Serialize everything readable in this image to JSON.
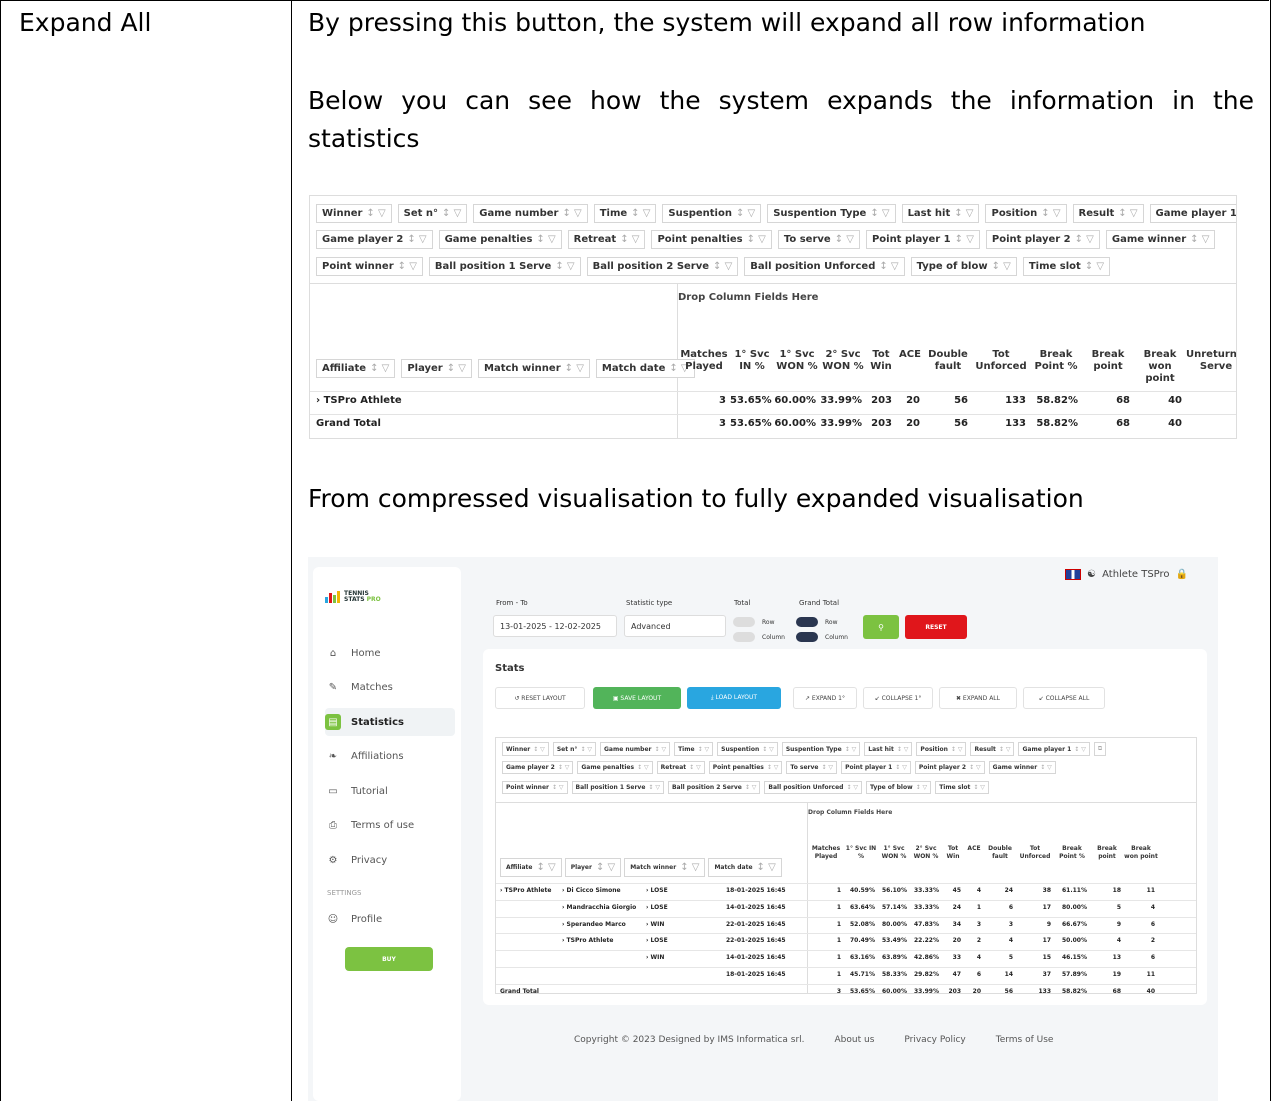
{
  "left_cell": "Expand All",
  "paragraphs": {
    "p1": "By pressing this button, the system will expand all row information",
    "p2": "Below you can see how the system expands the information in the statistics",
    "p3": "From compressed visualisation to fully expanded visualisation"
  },
  "pivot_fields": {
    "row1": [
      "Winner",
      "Set n°",
      "Game number",
      "Time",
      "Suspention",
      "Suspention Type",
      "Last hit",
      "Position",
      "Result",
      "Game player 1"
    ],
    "row2": [
      "Game player 2",
      "Game penalties",
      "Retreat",
      "Point penalties",
      "To serve",
      "Point player 1",
      "Point player 2",
      "Game winner"
    ],
    "row3": [
      "Point winner",
      "Ball position 1 Serve",
      "Ball position 2 Serve",
      "Ball position Unforced",
      "Type of blow",
      "Time slot"
    ],
    "drop_text": "Drop Column Fields Here",
    "row_headers": [
      "Affiliate",
      "Player",
      "Match winner",
      "Match date"
    ],
    "columns": [
      "Matches Played",
      "1° Svc IN %",
      "1° Svc WON %",
      "2° Svc WON %",
      "Tot Win",
      "ACE",
      "Double fault",
      "Tot Unforced",
      "Break Point %",
      "Break point",
      "Break won point",
      "Unreturned Serve"
    ]
  },
  "shot1": {
    "rows": [
      {
        "label": "TSPro Athlete",
        "values": [
          "3",
          "53.65%",
          "60.00%",
          "33.99%",
          "203",
          "20",
          "56",
          "133",
          "58.82%",
          "68",
          "40",
          "("
        ]
      },
      {
        "label": "Grand Total",
        "values": [
          "3",
          "53.65%",
          "60.00%",
          "33.99%",
          "203",
          "20",
          "56",
          "133",
          "58.82%",
          "68",
          "40",
          "("
        ]
      }
    ]
  },
  "shot2": {
    "logo": {
      "line1": "TENNIS",
      "line2": "STATS",
      "line3": "PRO"
    },
    "nav": [
      "Home",
      "Matches",
      "Statistics",
      "Affiliations",
      "Tutorial",
      "Terms of use",
      "Privacy"
    ],
    "settings_heading": "SETTINGS",
    "profile": "Profile",
    "buy": "BUY",
    "user": "Athlete TSPro",
    "filters": {
      "from_to_label": "From - To",
      "from_to_value": "13-01-2025 - 12-02-2025",
      "statistic_type_label": "Statistic type",
      "statistic_type_value": "Advanced",
      "total_label": "Total",
      "grand_total_label": "Grand Total",
      "row": "Row",
      "column": "Column",
      "reset": "RESET"
    },
    "stats_title": "Stats",
    "toolbar": [
      "RESET LAYOUT",
      "SAVE LAYOUT",
      "LOAD LAYOUT",
      "EXPAND 1°",
      "COLLAPSE 1°",
      "EXPAND ALL",
      "COLLAPSE ALL"
    ],
    "affiliate": "TSPro Athlete",
    "players": [
      "Di Cicco Simone",
      "Mandracchia Giorgio",
      "Sperandeo Marco",
      "TSPro Athlete"
    ],
    "rows": [
      {
        "winner": "LOSE",
        "date": "18-01-2025 16:45",
        "values": [
          "1",
          "40.59%",
          "56.10%",
          "33.33%",
          "45",
          "4",
          "24",
          "38",
          "61.11%",
          "18",
          "11"
        ]
      },
      {
        "winner": "LOSE",
        "date": "14-01-2025 16:45",
        "values": [
          "1",
          "63.64%",
          "57.14%",
          "33.33%",
          "24",
          "1",
          "6",
          "17",
          "80.00%",
          "5",
          "4"
        ]
      },
      {
        "winner": "WIN",
        "date": "22-01-2025 16:45",
        "values": [
          "1",
          "52.08%",
          "80.00%",
          "47.83%",
          "34",
          "3",
          "3",
          "9",
          "66.67%",
          "9",
          "6"
        ]
      },
      {
        "winner": "LOSE",
        "date": "22-01-2025 16:45",
        "values": [
          "1",
          "70.49%",
          "53.49%",
          "22.22%",
          "20",
          "2",
          "4",
          "17",
          "50.00%",
          "4",
          "2"
        ]
      },
      {
        "winner": "WIN",
        "date": "14-01-2025 16:45",
        "values": [
          "1",
          "63.16%",
          "63.89%",
          "42.86%",
          "33",
          "4",
          "5",
          "15",
          "46.15%",
          "13",
          "6"
        ]
      },
      {
        "winner": "",
        "date": "18-01-2025 16:45",
        "values": [
          "1",
          "45.71%",
          "58.33%",
          "29.82%",
          "47",
          "6",
          "14",
          "37",
          "57.89%",
          "19",
          "11"
        ]
      }
    ],
    "grand_total": {
      "label": "Grand Total",
      "values": [
        "3",
        "53.65%",
        "60.00%",
        "33.99%",
        "203",
        "20",
        "56",
        "133",
        "58.82%",
        "68",
        "40"
      ]
    },
    "footer": [
      "Copyright © 2023 Designed by IMS Informatica srl.",
      "About us",
      "Privacy Policy",
      "Terms of Use"
    ]
  },
  "colors": {
    "green": "#7cc241",
    "red": "#e0161b",
    "blue": "#29a6e0"
  }
}
